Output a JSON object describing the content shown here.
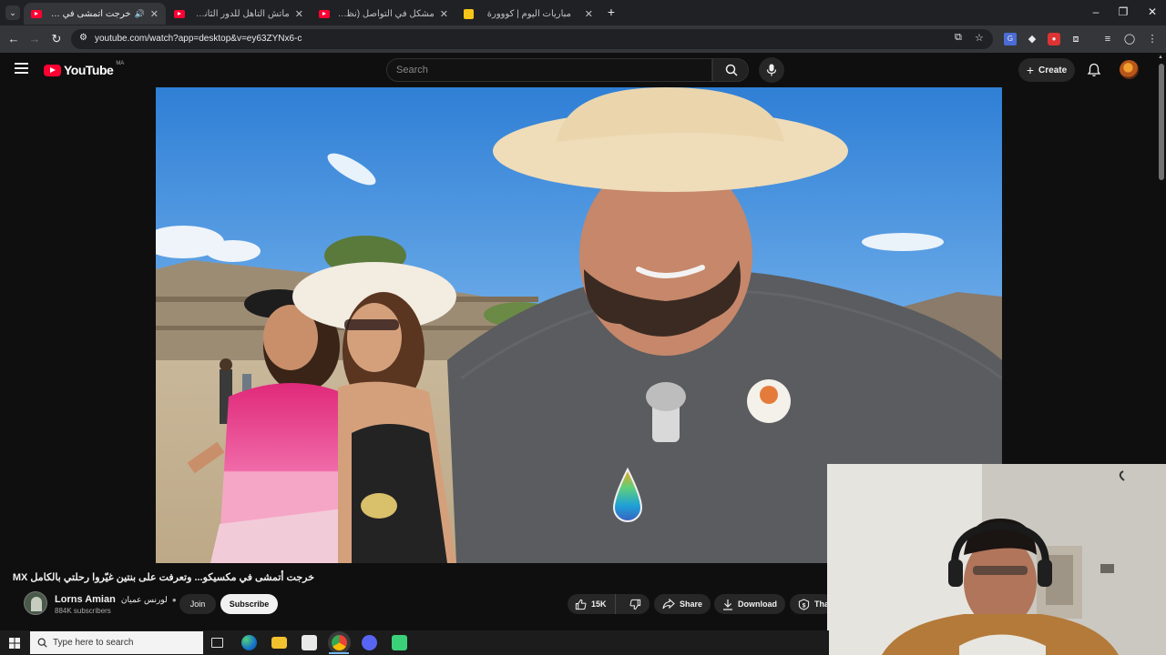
{
  "browser": {
    "tabs": [
      {
        "title": "خرجت أتمشى في مكسيكو...",
        "active": true
      },
      {
        "title": "ماتش التأهل للدور الثاني؟ (التشكيلة"
      },
      {
        "title": "مشكل في التواصل (نظرية البراكين"
      },
      {
        "title": "مباريات اليوم | كووورة"
      }
    ],
    "url": "youtube.com/watch?app=desktop&v=ey63ZYNx6-c"
  },
  "youtube": {
    "logo_text": "YouTube",
    "country_code": "MA",
    "search_placeholder": "Search",
    "create_label": "Create"
  },
  "video": {
    "title": "خرجت أتمشى في مكسيكو... وتعرفت على بنتين غيّروا رحلتي بالكامل MX",
    "channel_name": "Lorns Amian",
    "channel_name_ar": "لورنس عميان",
    "subscribers": "884K subscribers",
    "join_label": "Join",
    "subscribe_label": "Subscribe",
    "likes": "15K",
    "share_label": "Share",
    "download_label": "Download",
    "thanks_label": "Thanks"
  },
  "taskbar": {
    "search_placeholder": "Type here to search"
  },
  "icons": [
    "menu-icon",
    "search-icon",
    "mic-icon",
    "bell-icon",
    "like-icon",
    "dislike-icon",
    "share-icon",
    "download-icon",
    "thanks-icon",
    "windows-icon"
  ]
}
